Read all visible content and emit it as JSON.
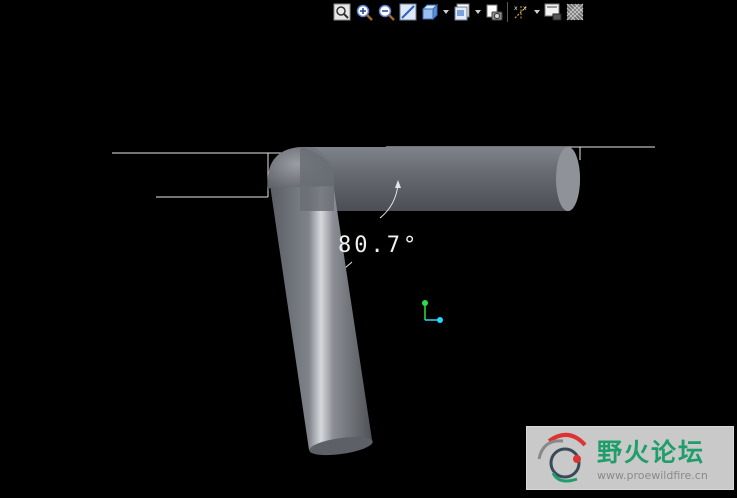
{
  "toolbar": {
    "buttons": [
      {
        "icon": "zoom-refit-icon"
      },
      {
        "icon": "zoom-in-icon"
      },
      {
        "icon": "zoom-out-icon"
      },
      {
        "icon": "repaint-icon"
      },
      {
        "icon": "display-style-icon",
        "has_dropdown": true
      },
      {
        "icon": "saved-views-icon",
        "has_dropdown": true
      },
      {
        "icon": "view-manager-icon"
      },
      {
        "icon": "datum-display-icon",
        "has_dropdown": true
      },
      {
        "icon": "annotation-display-icon"
      },
      {
        "icon": "spin-center-icon"
      }
    ]
  },
  "model": {
    "angle_dimension": "80.7°",
    "colors": {
      "pipe_light": "#c9cbcf",
      "pipe_mid": "#8c9096",
      "pipe_dark": "#55595f",
      "dimension_line": "#e6e6e6",
      "axis_y": "#27e04a",
      "axis_x": "#29d6ff"
    }
  },
  "watermark": {
    "title": "野火论坛",
    "url": "www.proewildfire.cn"
  }
}
